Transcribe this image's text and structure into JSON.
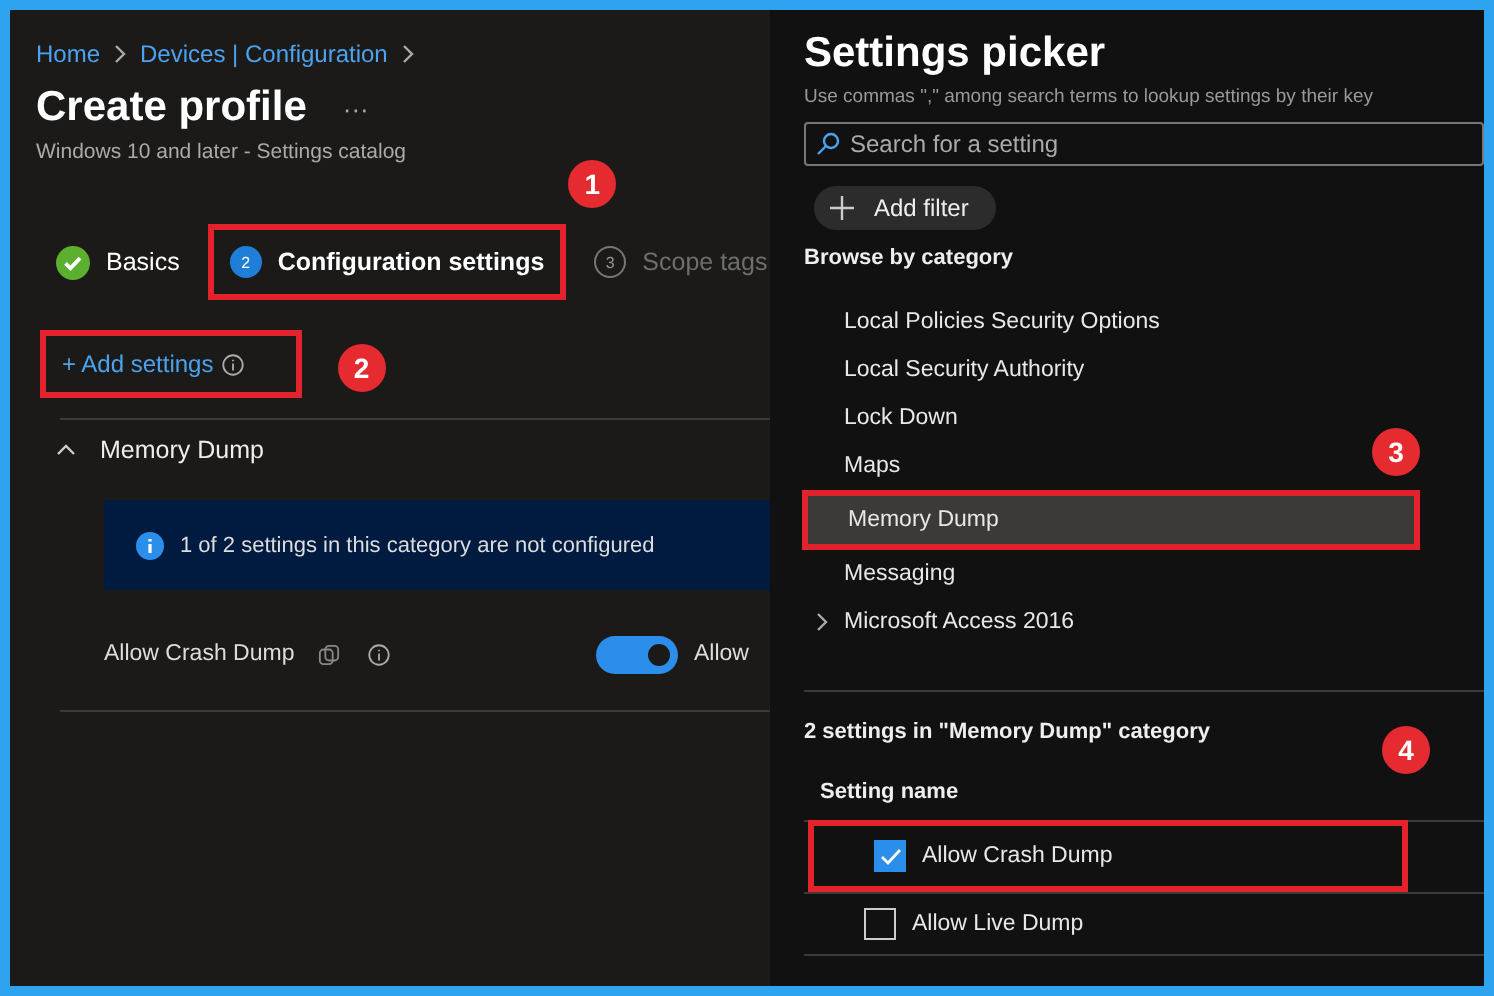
{
  "breadcrumb": [
    {
      "label": "Home"
    },
    {
      "label": "Devices | Configuration"
    }
  ],
  "page": {
    "title": "Create profile",
    "more": "···",
    "subtitle": "Windows 10 and later - Settings catalog"
  },
  "steps": [
    {
      "kind": "done",
      "label": "Basics",
      "selected": false
    },
    {
      "kind": "current",
      "number": "2",
      "label": "Configuration settings",
      "selected": true,
      "callout": "1"
    },
    {
      "kind": "pending",
      "number": "3",
      "label": "Scope tags",
      "selected": false
    }
  ],
  "add_settings": {
    "label": "+ Add settings",
    "callout": "2"
  },
  "section": {
    "title": "Memory Dump",
    "expanded": true,
    "info": "1 of 2 settings in this category are not configured",
    "settings": [
      {
        "name": "Allow Crash Dump",
        "on": true,
        "value": "Allow"
      }
    ]
  },
  "picker": {
    "title": "Settings picker",
    "hint": "Use commas \",\" among search terms to lookup settings by their key",
    "search": {
      "placeholder": "Search for a setting"
    },
    "add_filter": "Add filter",
    "browse_heading": "Browse by category",
    "categories": [
      {
        "label": "Local Policies Security Options",
        "selected": false,
        "expandable": false
      },
      {
        "label": "Local Security Authority",
        "selected": false,
        "expandable": false
      },
      {
        "label": "Lock Down",
        "selected": false,
        "expandable": false
      },
      {
        "label": "Maps",
        "selected": false,
        "expandable": false
      },
      {
        "label": "Memory Dump",
        "selected": true,
        "expandable": false,
        "callout": "3"
      },
      {
        "label": "Messaging",
        "selected": false,
        "expandable": false
      },
      {
        "label": "Microsoft Access 2016",
        "selected": false,
        "expandable": true
      }
    ],
    "results_heading": "2 settings in \"Memory Dump\" category",
    "column": "Setting name",
    "settings": [
      {
        "name": "Allow Crash Dump",
        "checked": true,
        "callout": "4"
      },
      {
        "name": "Allow Live Dump",
        "checked": false
      }
    ]
  }
}
